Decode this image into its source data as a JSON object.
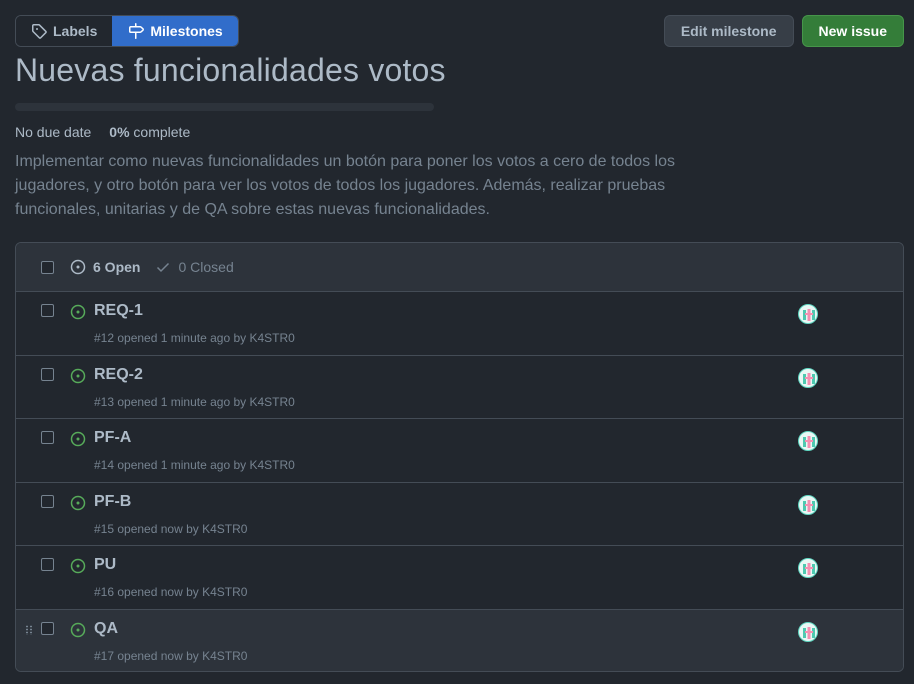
{
  "nav": {
    "labels": "Labels",
    "milestones": "Milestones"
  },
  "actions": {
    "edit": "Edit milestone",
    "new_issue": "New issue"
  },
  "milestone": {
    "title": "Nuevas funcionalidades votos",
    "due": "No due date",
    "percent": "0%",
    "percent_label": "complete",
    "progress": 0,
    "description": "Implementar como nuevas funcionalidades un botón para poner los votos a cero de todos los jugadores, y otro botón para ver los votos de todos los jugadores. Además, realizar pruebas funcionales, unitarias y de QA sobre estas nuevas funcionalidades."
  },
  "filters": {
    "open": "6 Open",
    "closed": "0 Closed"
  },
  "issues": [
    {
      "title": "REQ-1",
      "meta": "#12 opened 1 minute ago by K4STR0"
    },
    {
      "title": "REQ-2",
      "meta": "#13 opened 1 minute ago by K4STR0"
    },
    {
      "title": "PF-A",
      "meta": "#14 opened 1 minute ago by K4STR0"
    },
    {
      "title": "PF-B",
      "meta": "#15 opened now by K4STR0"
    },
    {
      "title": "PU",
      "meta": "#16 opened now by K4STR0"
    },
    {
      "title": "QA",
      "meta": "#17 opened now by K4STR0"
    }
  ],
  "colors": {
    "accent": "#316dca",
    "open_icon": "#57ab5a",
    "primary_button": "#347d39"
  }
}
